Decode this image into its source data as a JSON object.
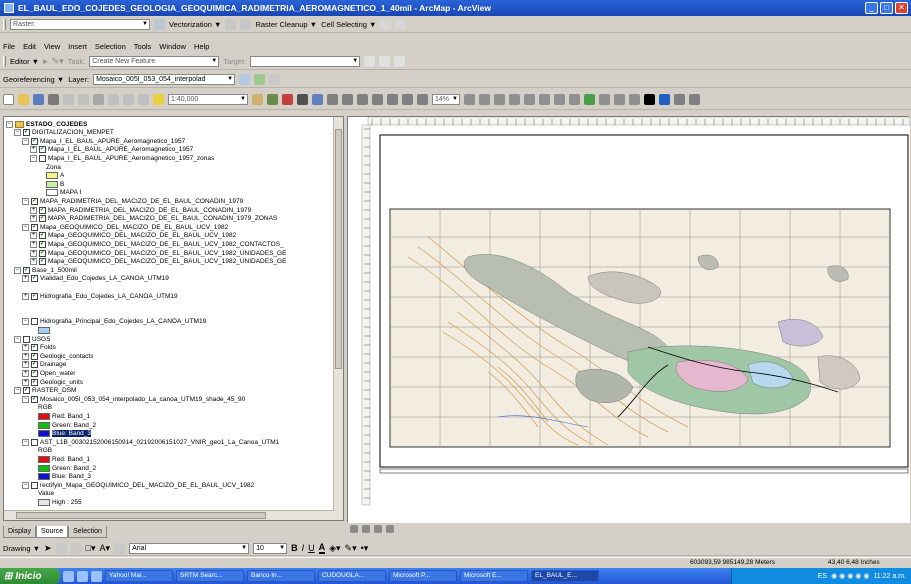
{
  "window": {
    "title": "EL_BAUL_EDO_COJEDES_GEOLOGIA_GEOQUIMICA_RADIMETRIA_AEROMAGNETICO_1_40mil - ArcMap - ArcView",
    "minimize": "_",
    "maximize": "□",
    "close": "✕"
  },
  "toolbar_raster": {
    "combo": "Raster:",
    "vectorization": "Vectorization ▼",
    "raster_cleanup": "Raster Cleanup ▼",
    "cell_selection": "Cell Selecting ▼"
  },
  "menu": [
    "File",
    "Edit",
    "View",
    "Insert",
    "Selection",
    "Tools",
    "Window",
    "Help"
  ],
  "editor": {
    "label": "Editor ▼",
    "task_label": "Task:",
    "task_value": "Create New Feature",
    "target_label": "Target:"
  },
  "georef": {
    "label": "Georeferencing ▼",
    "layer_label": "Layer:",
    "layer_value": "Mosaico_005I_053_054_interpolad"
  },
  "standard": {
    "scale": "1:40,000",
    "zoom": "14%"
  },
  "toc": {
    "rows": [
      {
        "label": "ESTADO_COJEDES",
        "level": 0,
        "pm": "−",
        "cb": "",
        "bold": true
      },
      {
        "label": "DIGITALIZACION_MENPET",
        "level": 1,
        "pm": "−",
        "cb": "✓"
      },
      {
        "label": "Mapa_I_EL_BAUL_APURE_Aeromagnetico_1957",
        "level": 2,
        "pm": "−",
        "cb": "✓"
      },
      {
        "label": "Mapa_I_EL_BAUL_APURE_Aeromagnetico_1957",
        "level": 3,
        "pm": "+",
        "cb": "✓"
      },
      {
        "label": "Mapa_I_EL_BAUL_APURE_Aeromagnetico_1957_zonas",
        "level": 3,
        "pm": "−",
        "cb": ""
      },
      {
        "label": "Zona",
        "level": 5,
        "pm": "",
        "cb": ""
      },
      {
        "label": "A",
        "level": 5,
        "pm": "",
        "cb": "",
        "swatch": "#f5f58a"
      },
      {
        "label": "B",
        "level": 5,
        "pm": "",
        "cb": "",
        "swatch": "#c8f0a0"
      },
      {
        "label": "MAPA I",
        "level": 5,
        "pm": "",
        "cb": "",
        "swatch": "#ffffff"
      },
      {
        "label": "MAPA_RADIMETRIA_DEL_MACIZO_DE_EL_BAUL_CONADIN_1979",
        "level": 2,
        "pm": "−",
        "cb": "✓"
      },
      {
        "label": "MAPA_RADIMETRIA_DEL_MACIZO_DE_EL_BAUL_CONADIN_1979",
        "level": 3,
        "pm": "+",
        "cb": "✓"
      },
      {
        "label": "MAPA_RADIMETRIA_DEL_MACIZO_DE_EL_BAUL_CONADIN_1979_ZONAS",
        "level": 3,
        "pm": "+",
        "cb": "✓"
      },
      {
        "label": "Mapa_GEOQUIMICO_DEL_MACIZO_DE_EL_BAUL_UCV_1982",
        "level": 2,
        "pm": "−",
        "cb": "✓"
      },
      {
        "label": "Mapa_GEOQUIMICO_DEL_MACIZO_DE_EL_BAUL_UCV_1982",
        "level": 3,
        "pm": "+",
        "cb": "✓"
      },
      {
        "label": "Mapa_GEOQUIMICO_DEL_MACIZO_DE_EL_BAUL_UCV_1982_CONTACTOS_",
        "level": 3,
        "pm": "+",
        "cb": "✓"
      },
      {
        "label": "Mapa_GEOQUIMICO_DEL_MACIZO_DE_EL_BAUL_UCV_1982_UNIDADES_GE",
        "level": 3,
        "pm": "+",
        "cb": "✓"
      },
      {
        "label": "Mapa_GEOQUIMICO_DEL_MACIZO_DE_EL_BAUL_UCV_1982_UNIDADES_GE",
        "level": 3,
        "pm": "+",
        "cb": "✓"
      },
      {
        "label": "Base_1_500mil",
        "level": 1,
        "pm": "−",
        "cb": "✓"
      },
      {
        "label": "Vialidad_Edo_Cojedes_LA_CANOA_UTM19",
        "level": 2,
        "pm": "+",
        "cb": "✓"
      },
      {
        "label": "",
        "level": 2,
        "pm": "",
        "cb": ""
      },
      {
        "label": "Hidrografia_Edo_Cojedes_LA_CANOA_UTM19",
        "level": 2,
        "pm": "+",
        "cb": "✓"
      },
      {
        "label": "",
        "level": 2,
        "pm": "",
        "cb": ""
      },
      {
        "label": "",
        "level": 2,
        "pm": "",
        "cb": ""
      },
      {
        "label": "Hidrografia_Principal_Edo_Cojedes_LA_CANOA_UTM19",
        "level": 2,
        "pm": "−",
        "cb": ""
      },
      {
        "label": "",
        "level": 4,
        "pm": "",
        "cb": "",
        "swatch": "#a8d0f0"
      },
      {
        "label": "USGS",
        "level": 1,
        "pm": "−",
        "cb": ""
      },
      {
        "label": "Folds",
        "level": 2,
        "pm": "+",
        "cb": "✓"
      },
      {
        "label": "Geologic_contacts",
        "level": 2,
        "pm": "+",
        "cb": "✓"
      },
      {
        "label": "Drainage",
        "level": 2,
        "pm": "+",
        "cb": "✓"
      },
      {
        "label": "Open_water",
        "level": 2,
        "pm": "+",
        "cb": "✓"
      },
      {
        "label": "Geologic_units",
        "level": 2,
        "pm": "+",
        "cb": "✓"
      },
      {
        "label": "RASTER_DSM",
        "level": 1,
        "pm": "−",
        "cb": "✓"
      },
      {
        "label": "Mosaico_005I_053_054_interpolado_La_canoa_UTM19_shade_45_90",
        "level": 2,
        "pm": "−",
        "cb": "✓"
      },
      {
        "label": "RGB",
        "level": 4,
        "pm": "",
        "cb": ""
      },
      {
        "label": "Red:   Band_1",
        "level": 4,
        "pm": "",
        "cb": "",
        "swatch": "#e01010"
      },
      {
        "label": "Green: Band_2",
        "level": 4,
        "pm": "",
        "cb": "",
        "swatch": "#10c010"
      },
      {
        "label": "Blue:  Band_3",
        "level": 4,
        "pm": "",
        "cb": "",
        "swatch": "#1010d0",
        "selected": true
      },
      {
        "label": "AST_L1B_00302152006150914_02192006151027_VNIR_geo1_La_Canoa_UTM1",
        "level": 2,
        "pm": "−",
        "cb": ""
      },
      {
        "label": "RGB",
        "level": 4,
        "pm": "",
        "cb": ""
      },
      {
        "label": "Red:   Band_1",
        "level": 4,
        "pm": "",
        "cb": "",
        "swatch": "#e01010"
      },
      {
        "label": "Green: Band_2",
        "level": 4,
        "pm": "",
        "cb": "",
        "swatch": "#10c010"
      },
      {
        "label": "Blue:  Band_3",
        "level": 4,
        "pm": "",
        "cb": "",
        "swatch": "#1010d0"
      },
      {
        "label": "rectifyin_Mapa_GEOQUIMICO_DEL_MACIZO_DE_EL_BAUL_UCV_1982",
        "level": 2,
        "pm": "−",
        "cb": ""
      },
      {
        "label": "Value",
        "level": 4,
        "pm": "",
        "cb": ""
      },
      {
        "label": "High : 255",
        "level": 4,
        "pm": "",
        "cb": "",
        "swatch": "#e8e8e8"
      }
    ]
  },
  "tabs": [
    "Display",
    "Source",
    "Selection"
  ],
  "draw": {
    "drawing": "Drawing ▼",
    "font": "Arial",
    "size": "10",
    "bold": "B",
    "italic": "I",
    "underline": "U",
    "textA": "A"
  },
  "status": {
    "coords": "603093,59 985149,28 Meters",
    "page": "43,40 6,48 Inches"
  },
  "taskbar": {
    "start": "Inicio",
    "tasks": [
      "Yahoo! Mai...",
      "SRTM Searc...",
      "Banco In...",
      "CUDOUGLA...",
      "Microsoft P...",
      "Microsoft E...",
      "EL_BAUL_E..."
    ],
    "lang": "ES",
    "clock": "11:22 a.m."
  }
}
